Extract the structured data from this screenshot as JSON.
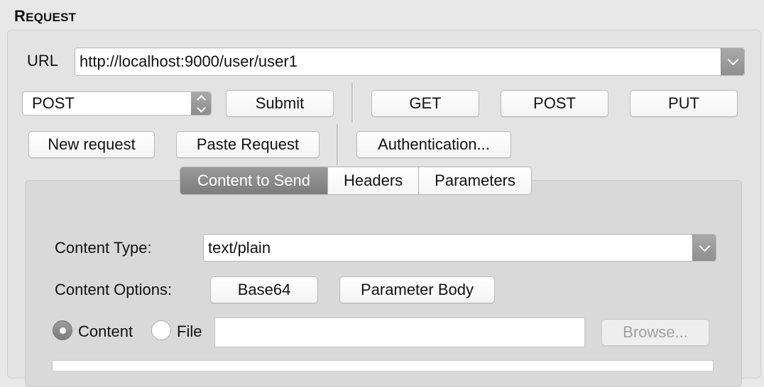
{
  "section": {
    "title_first": "R",
    "title_rest": "EQUEST"
  },
  "url": {
    "label": "URL",
    "value": "http://localhost:9000/user/user1"
  },
  "method_select": {
    "selected": "POST"
  },
  "buttons": {
    "submit": "Submit",
    "get": "GET",
    "post": "POST",
    "put": "PUT",
    "new_request": "New request",
    "paste_request": "Paste Request",
    "authentication": "Authentication..."
  },
  "tabs": [
    {
      "label": "Content to Send",
      "active": true
    },
    {
      "label": "Headers",
      "active": false
    },
    {
      "label": "Parameters",
      "active": false
    }
  ],
  "content": {
    "type_label": "Content Type:",
    "type_value": "text/plain",
    "options_label": "Content Options:",
    "base64": "Base64",
    "parameter_body": "Parameter Body",
    "radio_content": "Content",
    "radio_file": "File",
    "file_path": "",
    "browse": "Browse..."
  }
}
